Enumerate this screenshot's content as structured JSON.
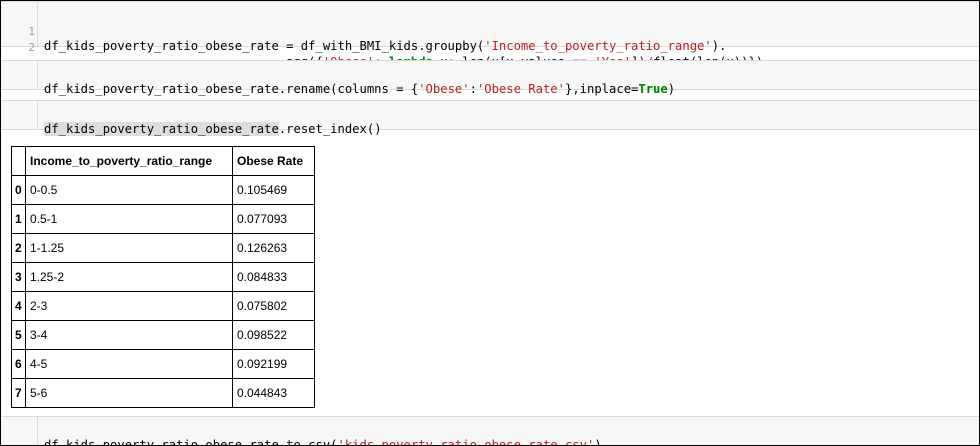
{
  "cells": [
    {
      "lines": [
        {
          "num": "1",
          "segments": [
            {
              "t": "df_kids_poverty_ratio_obese_rate = df_with_BMI_kids.groupby(",
              "c": ""
            },
            {
              "t": "'Income_to_poverty_ratio_range'",
              "c": "str"
            },
            {
              "t": ").",
              "c": ""
            }
          ]
        },
        {
          "num": "2",
          "segments": [
            {
              "t": "                                 agg({",
              "c": ""
            },
            {
              "t": "'Obese'",
              "c": "str"
            },
            {
              "t": ": ",
              "c": ""
            },
            {
              "t": "lambda",
              "c": "kw"
            },
            {
              "t": " x: len(x[x.values ",
              "c": ""
            },
            {
              "t": "==",
              "c": "op"
            },
            {
              "t": " ",
              "c": ""
            },
            {
              "t": "'Yes'",
              "c": "str"
            },
            {
              "t": "])",
              "c": ""
            },
            {
              "t": "/",
              "c": "op"
            },
            {
              "t": "float(len(x))})",
              "c": ""
            }
          ]
        }
      ]
    },
    {
      "lines": [
        {
          "num": "",
          "segments": [
            {
              "t": "df_kids_poverty_ratio_obese_rate.rename(columns = {",
              "c": ""
            },
            {
              "t": "'Obese'",
              "c": "str"
            },
            {
              "t": ":",
              "c": ""
            },
            {
              "t": "'Obese Rate'",
              "c": "str"
            },
            {
              "t": "},inplace=",
              "c": ""
            },
            {
              "t": "True",
              "c": "kw"
            },
            {
              "t": ")",
              "c": ""
            }
          ]
        }
      ]
    },
    {
      "lines": [
        {
          "num": "",
          "segments": [
            {
              "t": "df_kids_poverty_ratio_obese_rate",
              "c": "hl"
            },
            {
              "t": ".reset_index()",
              "c": ""
            }
          ]
        }
      ]
    },
    {
      "lines": [
        {
          "num": "",
          "segments": [
            {
              "t": "df_kids_poverty_ratio_obese_rate.to_csv(",
              "c": ""
            },
            {
              "t": "'kids_poverty_ratio_obese_rate.csv'",
              "c": "str"
            },
            {
              "t": ")",
              "c": ""
            }
          ]
        }
      ]
    }
  ],
  "table": {
    "headers": [
      "",
      "Income_to_poverty_ratio_range",
      "Obese Rate"
    ],
    "rows": [
      {
        "index": "0",
        "range": "0-0.5",
        "rate": "0.105469"
      },
      {
        "index": "1",
        "range": "0.5-1",
        "rate": "0.077093"
      },
      {
        "index": "2",
        "range": "1-1.25",
        "rate": "0.126263"
      },
      {
        "index": "3",
        "range": "1.25-2",
        "rate": "0.084833"
      },
      {
        "index": "4",
        "range": "2-3",
        "rate": "0.075802"
      },
      {
        "index": "5",
        "range": "3-4",
        "rate": "0.098522"
      },
      {
        "index": "6",
        "range": "4-5",
        "rate": "0.092199"
      },
      {
        "index": "7",
        "range": "5-6",
        "rate": "0.044843"
      }
    ]
  }
}
